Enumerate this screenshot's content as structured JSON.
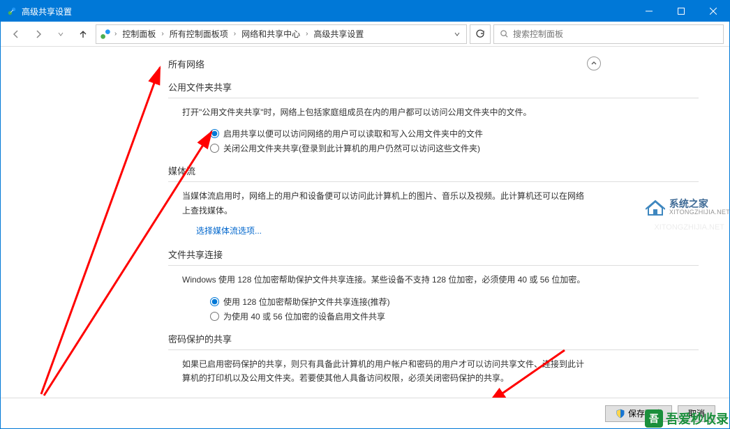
{
  "titlebar": {
    "title": "高级共享设置"
  },
  "breadcrumb": {
    "items": [
      "控制面板",
      "所有控制面板项",
      "网络和共享中心",
      "高级共享设置"
    ]
  },
  "search": {
    "placeholder": "搜索控制面板"
  },
  "section": {
    "all_networks": "所有网络",
    "public_folder": {
      "title": "公用文件夹共享",
      "desc": "打开\"公用文件夹共享\"时，网络上包括家庭组成员在内的用户都可以访问公用文件夹中的文件。",
      "opt_on": "启用共享以便可以访问网络的用户可以读取和写入公用文件夹中的文件",
      "opt_off": "关闭公用文件夹共享(登录到此计算机的用户仍然可以访问这些文件夹)"
    },
    "media": {
      "title": "媒体流",
      "desc": "当媒体流启用时，网络上的用户和设备便可以访问此计算机上的图片、音乐以及视频。此计算机还可以在网络上查找媒体。",
      "link": "选择媒体流选项..."
    },
    "file_conn": {
      "title": "文件共享连接",
      "desc": "Windows 使用 128 位加密帮助保护文件共享连接。某些设备不支持 128 位加密，必须使用 40 或 56 位加密。",
      "opt_128": "使用 128 位加密帮助保护文件共享连接(推荐)",
      "opt_40": "为使用 40 或 56 位加密的设备启用文件共享"
    },
    "password": {
      "title": "密码保护的共享",
      "desc": "如果已启用密码保护的共享，则只有具备此计算机的用户帐户和密码的用户才可以访问共享文件、连接到此计算机的打印机以及公用文件夹。若要使其他人具备访问权限，必须关闭密码保护的共享。"
    }
  },
  "footer": {
    "save": "保存更改",
    "cancel": "取消"
  },
  "watermark": {
    "cn": "系统之家",
    "en": "XITONGZHIJIA.NET",
    "bottom": "吾爱秒收录"
  }
}
